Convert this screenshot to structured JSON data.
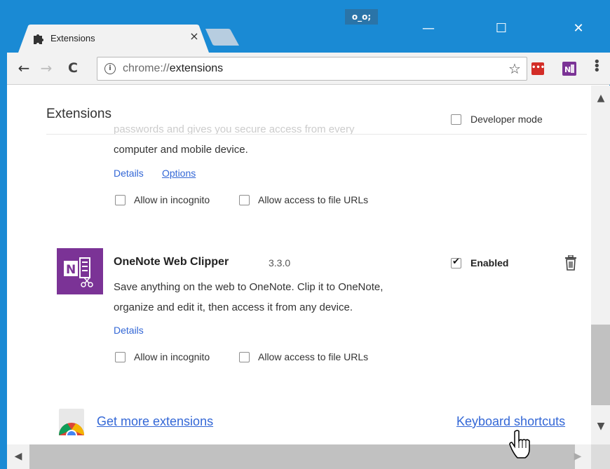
{
  "window": {
    "profile_label": "o_o;",
    "minimize_glyph": "—",
    "maximize_glyph": "☐",
    "close_glyph": "✕"
  },
  "tab": {
    "title": "Extensions",
    "close_glyph": "×",
    "icon": "puzzle-icon"
  },
  "toolbar": {
    "back_glyph": "←",
    "forward_glyph": "→",
    "reload_glyph": "C",
    "url_scheme": "chrome://",
    "url_path": "extensions",
    "star_glyph": "☆",
    "lastpass_label": "•••",
    "menu_glyph": "⋮"
  },
  "page": {
    "title": "Extensions",
    "developer_mode_label": "Developer mode",
    "developer_mode_checked": false
  },
  "extensions": [
    {
      "desc_line1_faded": "passwords and gives you secure access from every",
      "desc_line2": "computer and mobile device.",
      "details_label": "Details",
      "options_label": "Options",
      "incognito_label": "Allow in incognito",
      "file_urls_label": "Allow access to file URLs"
    },
    {
      "name": "OneNote Web Clipper",
      "version": "3.3.0",
      "enabled_label": "Enabled",
      "enabled": true,
      "desc_line1": "Save anything on the web to OneNote. Clip it to OneNote,",
      "desc_line2": "organize and edit it, then access it from any device.",
      "details_label": "Details",
      "incognito_label": "Allow in incognito",
      "file_urls_label": "Allow access to file URLs"
    }
  ],
  "footer": {
    "get_more_label": "Get more extensions",
    "shortcuts_label": "Keyboard shortcuts"
  },
  "scrollbars": {
    "up_glyph": "▲",
    "down_glyph": "▼",
    "left_glyph": "◀",
    "right_glyph": "▶"
  },
  "colors": {
    "titlebar": "#1a8ad4",
    "link": "#3367d6",
    "onenote_purple": "#7b3396",
    "lastpass_red": "#d32d27"
  }
}
